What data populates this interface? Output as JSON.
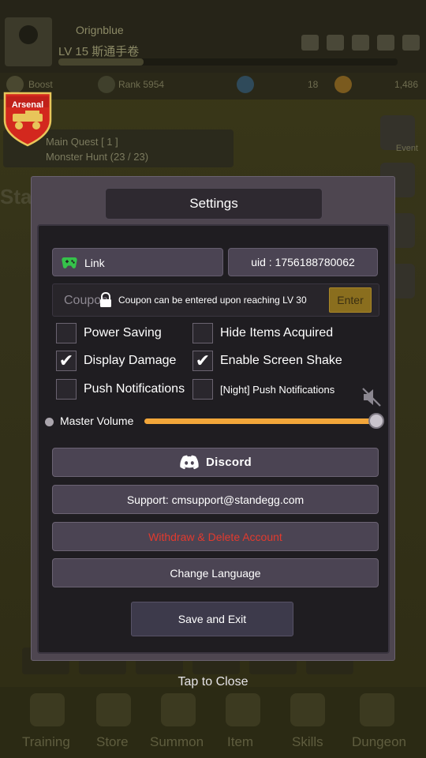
{
  "background": {
    "player_name": "Orignblue",
    "player_level": "LV 15 斯通手卷",
    "resource_1": "Boost",
    "resource_2": "Rank 5954",
    "resource_3": "18",
    "resource_4": "1,486",
    "logo_text": "Arsenal",
    "quest_title": "Main Quest [ 1 ]",
    "quest_sub": "Monster Hunt (23 / 23)",
    "side_label": "Event",
    "stage_text": "Stage",
    "nav": [
      "Training",
      "Store",
      "Summon",
      "Item",
      "Skills",
      "Dungeon"
    ]
  },
  "dialog": {
    "title": "Settings",
    "link_label": "Link",
    "uid_label": "uid : 1756188780062",
    "coupon": {
      "placeholder": "Coupon",
      "message": "Coupon can be entered upon reaching LV 30",
      "enter_label": "Enter"
    },
    "options": {
      "power_saving": {
        "label": "Power Saving",
        "checked": false,
        "mark": ""
      },
      "hide_items": {
        "label": "Hide Items Acquired",
        "checked": false,
        "mark": ""
      },
      "display_damage": {
        "label": "Display Damage",
        "checked": true,
        "mark": "✔"
      },
      "screen_shake": {
        "label": "Enable Screen Shake",
        "checked": true,
        "mark": "✔"
      },
      "push_notifications": {
        "label": "Push Notifications",
        "checked": false,
        "mark": ""
      },
      "night_push": {
        "label": "[Night] Push Notifications",
        "checked": false,
        "mark": ""
      }
    },
    "volume": {
      "label": "Master Volume",
      "level": 1.0,
      "muted_icon": "speaker-muted-icon"
    },
    "discord_label": "Discord",
    "support_label": "Support: cmsupport@standegg.com",
    "withdraw_label": "Withdraw & Delete Account",
    "language_label": "Change Language",
    "save_label": "Save and Exit"
  },
  "tap_to_close": "Tap to Close",
  "colors": {
    "accent_orange": "#f2a63a",
    "danger_red": "#e23a2e",
    "enter_gold": "#8a6e1e",
    "play_green": "#35c24a",
    "discord_white": "#ffffff"
  }
}
